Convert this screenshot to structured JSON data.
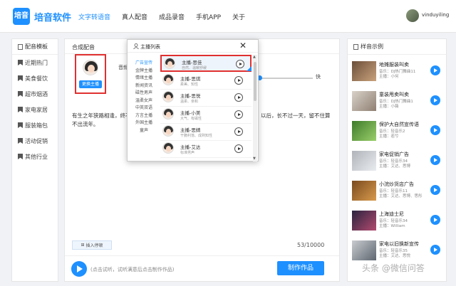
{
  "header": {
    "logo_text": "培音",
    "app_name": "培音软件",
    "nav": [
      "文字转语音",
      "真人配音",
      "成品录音",
      "手机APP",
      "关于"
    ],
    "username": "vinduyiling"
  },
  "left_panel": {
    "title": "配音模板",
    "categories": [
      "近期热门",
      "美食餐饮",
      "超市烟酒",
      "家电家居",
      "服装箱包",
      "活动促销",
      "其他行业"
    ]
  },
  "center": {
    "title": "合成配音",
    "change_host": "更换主播",
    "volume_label": "音频",
    "speed_fast": "快",
    "text_left": "有生之年狭路相逢，终不能幸免，手",
    "text_right": "以后，长不过一天，留不住算",
    "text_line2": "不出流年。",
    "insert_pause": "插入停顿",
    "count": "53/10000",
    "hint": "(点击试听，试听满意后点击制作作品)",
    "make_button": "制作作品"
  },
  "popup": {
    "title": "主播列表",
    "categories": [
      "广告宣传",
      "金牌主播",
      "情绪主播",
      "新闻资讯",
      "磁性男声",
      "温柔女声",
      "中英双语",
      "方言主播",
      "外国主播",
      "童声"
    ],
    "voices": [
      {
        "name": "主播-思佳",
        "tags": "自然、温暖舒缓"
      },
      {
        "name": "主播-思琪",
        "tags": "柔美、知性"
      },
      {
        "name": "主播-思悦",
        "tags": "温柔、亲和"
      },
      {
        "name": "主播-小美",
        "tags": "大气、有磁性"
      },
      {
        "name": "主播-思婧",
        "tags": "干脆利落、成熟知性"
      },
      {
        "name": "主播-艾达",
        "tags": "标准男声"
      }
    ]
  },
  "right_panel": {
    "title": "样音示例",
    "samples": [
      {
        "title": "地摊服装叫卖",
        "meta1": "音乐：DJ热门舞曲11",
        "meta2": "主播：小何"
      },
      {
        "title": "童装甩卖叫卖",
        "meta1": "音乐：DJ热门舞曲1",
        "meta2": "主播：小薇"
      },
      {
        "title": "保护大自然宣传语",
        "meta1": "音乐：轻音乐2",
        "meta2": "主播：若兮"
      },
      {
        "title": "家电促销广告",
        "meta1": "音乐：轻音乐34",
        "meta2": "主播：艾达、思博"
      },
      {
        "title": "小浣炒货店广告",
        "meta1": "音乐：轻音乐11",
        "meta2": "主播：艾达、思博、思彤"
      },
      {
        "title": "上海迪士尼",
        "meta1": "音乐：轻音乐34",
        "meta2": "主播：William"
      },
      {
        "title": "家电以旧换新宣传",
        "meta1": "音乐：轻音乐35",
        "meta2": "主播：艾达、思悦"
      }
    ]
  },
  "watermark": "头条 @微信问答",
  "colors": {
    "accent": "#1e90ff",
    "highlight": "#e03030"
  }
}
